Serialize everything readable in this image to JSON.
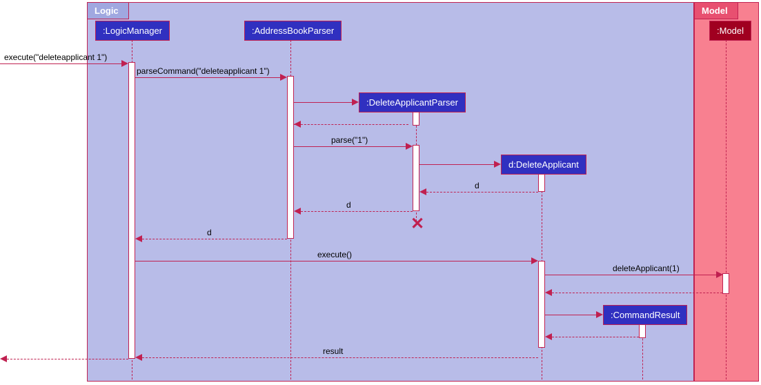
{
  "containers": {
    "logic": "Logic",
    "model": "Model"
  },
  "participants": {
    "logicManager": ":LogicManager",
    "addressBookParser": ":AddressBookParser",
    "deleteApplicantParser": ":DeleteApplicantParser",
    "deleteApplicant": "d:DeleteApplicant",
    "commandResult": ":CommandResult",
    "model": ":Model"
  },
  "messages": {
    "execute1": "execute(\"deleteapplicant 1\")",
    "parseCommand": "parseCommand(\"deleteapplicant 1\")",
    "parse1": "parse(\"1\")",
    "returnD1": "d",
    "returnD2": "d",
    "returnD3": "d",
    "execute2": "execute()",
    "deleteApplicant1": "deleteApplicant(1)",
    "result": "result"
  }
}
